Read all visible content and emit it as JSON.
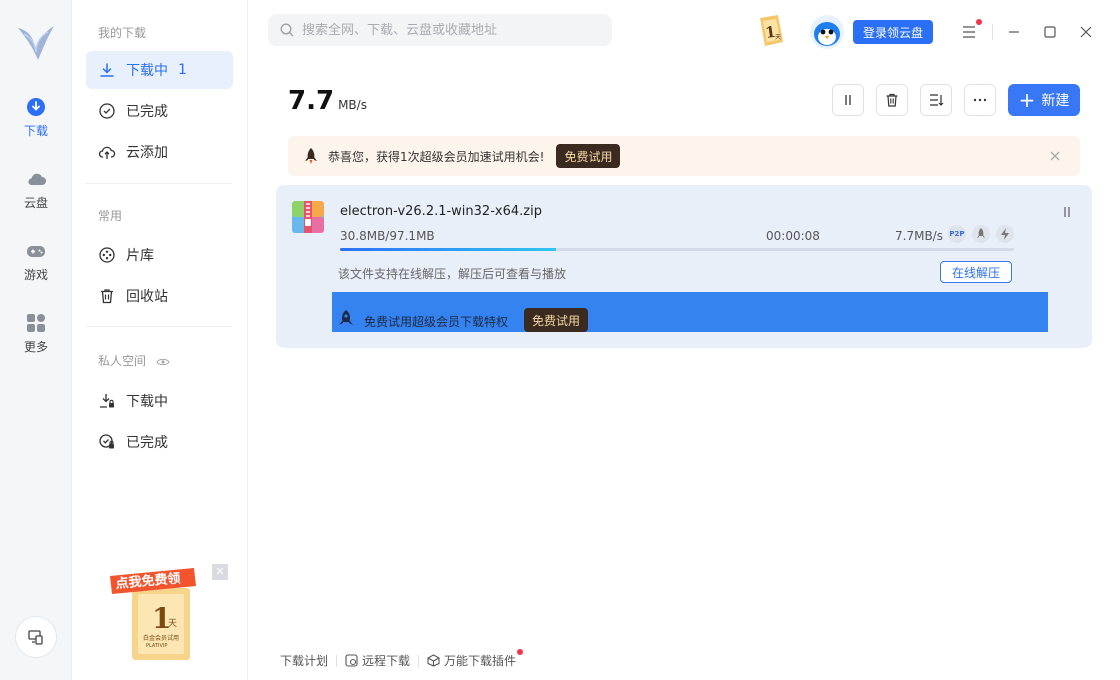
{
  "rail": {
    "items": [
      {
        "label": "下载",
        "icon": "download-icon"
      },
      {
        "label": "云盘",
        "icon": "cloud-icon"
      },
      {
        "label": "游戏",
        "icon": "gamepad-icon"
      },
      {
        "label": "更多",
        "icon": "grid-icon"
      }
    ]
  },
  "nav": {
    "section_my_downloads": "我的下载",
    "downloading": {
      "label": "下载中",
      "count": "1"
    },
    "completed": "已完成",
    "cloud_add": "云添加",
    "section_common": "常用",
    "library": "片库",
    "recycle": "回收站",
    "section_private": "私人空间",
    "private_downloading": "下载中",
    "private_completed": "已完成"
  },
  "promo": {
    "ribbon": "点我免费领",
    "days": "1",
    "day_unit": "天",
    "caption": "白金会员试用",
    "brand": "PLATIVIP"
  },
  "topbar": {
    "search_placeholder": "搜索全网、下载、云盘或收藏地址",
    "badge_number": "1",
    "badge_unit": "天",
    "login_label": "登录领云盘"
  },
  "speed": {
    "value": "7.7",
    "unit": "MB/s"
  },
  "toolbar": {
    "new_label": "新建"
  },
  "notice": {
    "text": "恭喜您，获得1次超级会员加速试用机会!",
    "button": "免费试用"
  },
  "task": {
    "filename": "electron-v26.2.1-win32-x64.zip",
    "size": "30.8MB/97.1MB",
    "time": "00:00:08",
    "speed": "7.7MB/s",
    "tag_p2p": "P2P",
    "progress": 0.32,
    "hint": "该文件支持在线解压，解压后可查看与播放",
    "unzip_label": "在线解压",
    "banner_text": "免费试用超级会员下载特权",
    "banner_button": "免费试用"
  },
  "footer": {
    "plan": "下载计划",
    "remote": "远程下载",
    "plugin": "万能下载插件"
  },
  "colors": {
    "accent": "#2b6ff7",
    "banner": "#3583f0",
    "notice_bg": "#fdf4ec",
    "card_bg": "#e9eff9"
  }
}
